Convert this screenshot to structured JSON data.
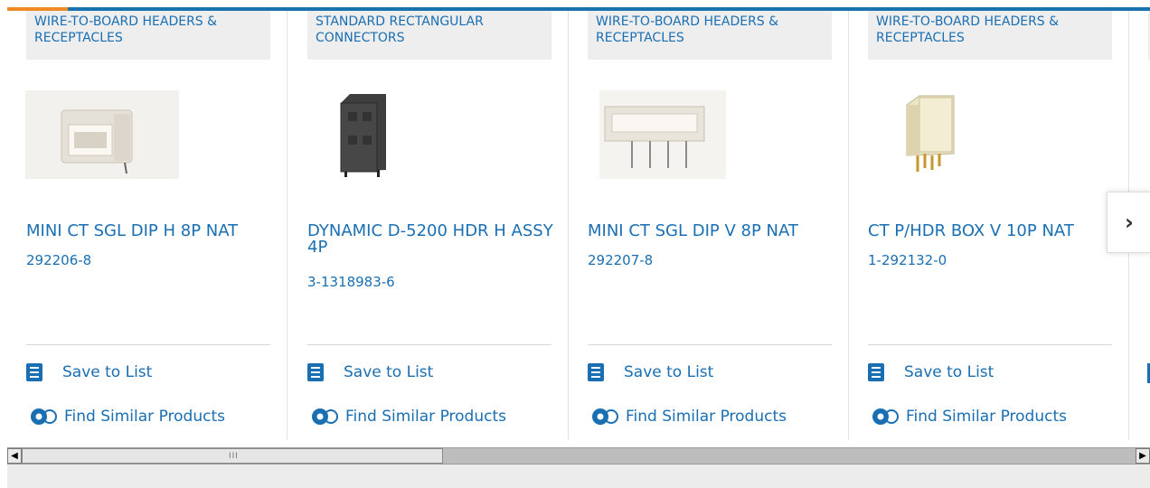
{
  "products": [
    {
      "category": "WIRE-TO-BOARD HEADERS & RECEPTACLES",
      "title": "MINI CT SGL DIP H 8P NAT",
      "part_number": "292206-8",
      "image": "white-horizontal-header-image"
    },
    {
      "category": "STANDARD RECTANGULAR CONNECTORS",
      "title": "DYNAMIC D-5200 HDR H ASSY 4P",
      "part_number": "3-1318983-6",
      "image": "black-connector-image"
    },
    {
      "category": "WIRE-TO-BOARD HEADERS & RECEPTACLES",
      "title": "MINI CT SGL DIP V 8P NAT",
      "part_number": "292207-8",
      "image": "white-vertical-header-image"
    },
    {
      "category": "WIRE-TO-BOARD HEADERS & RECEPTACLES",
      "title": "CT P/HDR BOX V 10P NAT",
      "part_number": "1-292132-0",
      "image": "box-header-gold-pins-image"
    }
  ],
  "actions": {
    "save_label": "Save to List",
    "similar_label": "Find Similar Products"
  },
  "nav": {
    "next_glyph": "›"
  },
  "scrollbar": {
    "left_arrow": "◀",
    "right_arrow": "▶",
    "grip": "III"
  },
  "colors": {
    "link": "#1a6fb3",
    "accent_orange": "#f08a24",
    "accent_blue": "#1a73ad"
  }
}
